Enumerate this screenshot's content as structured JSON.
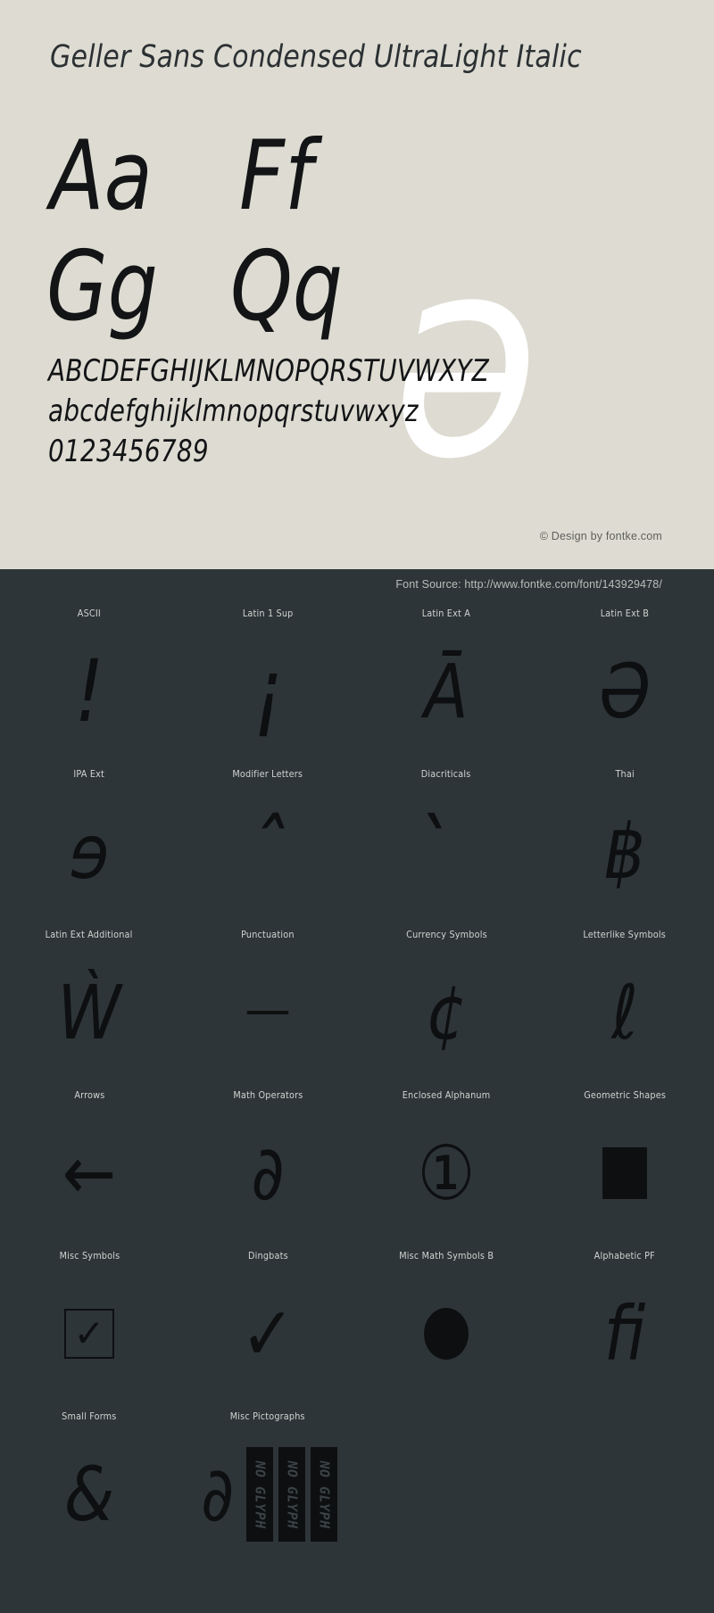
{
  "specimen": {
    "title": "Geller Sans Condensed UltraLight Italic",
    "letter_pairs": [
      {
        "name": "aa",
        "text": "Aa"
      },
      {
        "name": "ff",
        "text": "Ff"
      },
      {
        "name": "gg",
        "text": "Gg"
      },
      {
        "name": "qq",
        "text": "Qq"
      }
    ],
    "hero_glyph": "ə",
    "uppercase_line": "ABCDEFGHIJKLMNOPQRSTUVWXYZ",
    "lowercase_line": "abcdefghijklmnopqrstuvwxyz",
    "numerals_line": "0123456789",
    "credit": "© Design by fontke.com",
    "background_color": "#dedcd2",
    "text_color": "#121416",
    "hero_color": "#ffffff"
  },
  "glyph_map": {
    "source_line": "Font Source: http://www.fontke.com/font/143929478/",
    "background_color": "#2e3538",
    "label_color": "#cfd3d1",
    "glyph_color": "#0d0f11",
    "blocks": [
      {
        "label": "ASCII",
        "glyph": "!",
        "render": "text",
        "size": "glyph-large"
      },
      {
        "label": "Latin 1 Sup",
        "glyph": "¡",
        "render": "text",
        "size": "glyph-large"
      },
      {
        "label": "Latin Ext A",
        "glyph": "Ā",
        "render": "text",
        "size": ""
      },
      {
        "label": "Latin Ext B",
        "glyph": "Ə",
        "render": "text",
        "size": ""
      },
      {
        "label": "IPA Ext",
        "glyph": "ɘ",
        "render": "text",
        "size": ""
      },
      {
        "label": "Modifier Letters",
        "glyph": "ˆ",
        "render": "text",
        "size": "glyph-large"
      },
      {
        "label": "Diacriticals",
        "glyph": "̀",
        "render": "text",
        "size": "glyph-large"
      },
      {
        "label": "Thai",
        "glyph": "฿",
        "render": "text",
        "size": ""
      },
      {
        "label": "Latin Ext Additional",
        "glyph": "Ẁ",
        "render": "text",
        "size": ""
      },
      {
        "label": "Punctuation",
        "glyph": "—",
        "render": "dash",
        "size": ""
      },
      {
        "label": "Currency Symbols",
        "glyph": "¢",
        "render": "text",
        "size": ""
      },
      {
        "label": "Letterlike Symbols",
        "glyph": "ℓ",
        "render": "text",
        "size": ""
      },
      {
        "label": "Arrows",
        "glyph": "←",
        "render": "text",
        "size": ""
      },
      {
        "label": "Math Operators",
        "glyph": "∂",
        "render": "text",
        "size": ""
      },
      {
        "label": "Enclosed Alphanum",
        "glyph": "①",
        "render": "text",
        "size": ""
      },
      {
        "label": "Geometric Shapes",
        "glyph": "■",
        "render": "square",
        "size": ""
      },
      {
        "label": "Misc Symbols",
        "glyph": "☑",
        "render": "boxcheck",
        "size": ""
      },
      {
        "label": "Dingbats",
        "glyph": "✓",
        "render": "text",
        "size": ""
      },
      {
        "label": "Misc Math Symbols B",
        "glyph": "⬤",
        "render": "circle",
        "size": ""
      },
      {
        "label": "Alphabetic PF",
        "glyph": "ﬁ",
        "render": "text",
        "size": ""
      },
      {
        "label": "Small Forms",
        "glyph": "&",
        "render": "text",
        "size": ""
      },
      {
        "label": "Misc Pictographs",
        "glyph": "∂",
        "render": "noglyph",
        "size": ""
      }
    ],
    "no_glyph_label": "NO GLYPH",
    "no_glyph_count": 3
  }
}
